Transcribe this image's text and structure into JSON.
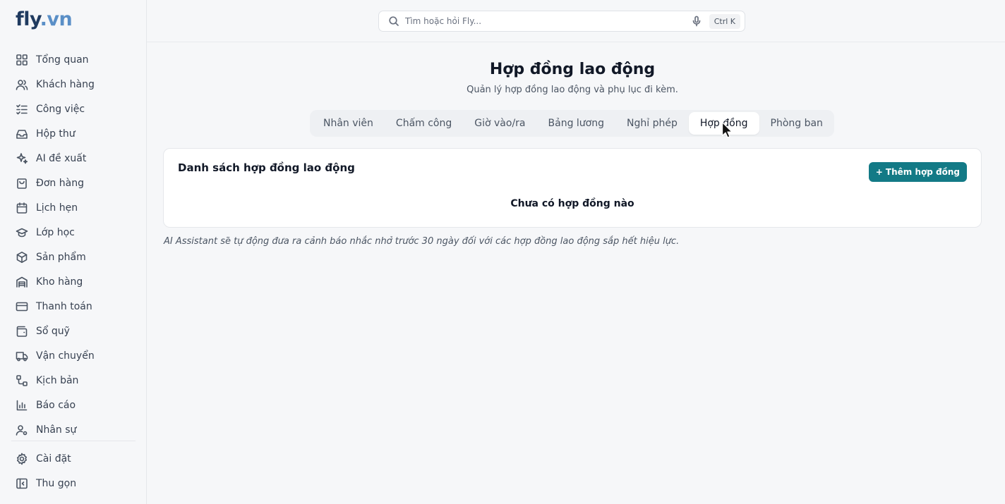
{
  "logo": {
    "part1": "fly",
    "part2": ".vn"
  },
  "search": {
    "placeholder": "Tìm hoặc hỏi Fly...",
    "shortcut": "Ctrl K"
  },
  "sidebar": {
    "items": [
      {
        "label": "Tổng quan",
        "icon": "grid-icon"
      },
      {
        "label": "Khách hàng",
        "icon": "users-icon"
      },
      {
        "label": "Công việc",
        "icon": "tasks-icon"
      },
      {
        "label": "Hộp thư",
        "icon": "inbox-icon"
      },
      {
        "label": "AI đề xuất",
        "icon": "sparkle-icon"
      },
      {
        "label": "Đơn hàng",
        "icon": "shopping-bag-icon"
      },
      {
        "label": "Lịch hẹn",
        "icon": "calendar-icon"
      },
      {
        "label": "Lớp học",
        "icon": "graduation-cap-icon"
      },
      {
        "label": "Sản phẩm",
        "icon": "box-icon"
      },
      {
        "label": "Kho hàng",
        "icon": "warehouse-icon"
      },
      {
        "label": "Thanh toán",
        "icon": "credit-card-icon"
      },
      {
        "label": "Sổ quỹ",
        "icon": "wallet-icon"
      },
      {
        "label": "Vận chuyển",
        "icon": "truck-icon"
      },
      {
        "label": "Kịch bản",
        "icon": "workflow-icon"
      },
      {
        "label": "Báo cáo",
        "icon": "bar-chart-icon"
      },
      {
        "label": "Nhân sự",
        "icon": "user-cog-icon"
      }
    ],
    "bottom": [
      {
        "label": "Cài đặt",
        "icon": "gear-icon"
      },
      {
        "label": "Thu gọn",
        "icon": "collapse-icon"
      }
    ]
  },
  "page": {
    "title": "Hợp đồng lao động",
    "subtitle": "Quản lý hợp đồng lao động và phụ lục đi kèm."
  },
  "tabs": [
    {
      "label": "Nhân viên"
    },
    {
      "label": "Chấm công"
    },
    {
      "label": "Giờ vào/ra"
    },
    {
      "label": "Bảng lương"
    },
    {
      "label": "Nghỉ phép"
    },
    {
      "label": "Hợp đồng"
    },
    {
      "label": "Phòng ban"
    }
  ],
  "active_tab": "Hợp đồng",
  "card": {
    "title": "Danh sách hợp đồng lao động",
    "add_button": "+ Thêm hợp đồng",
    "empty_text": "Chưa có hợp đồng nào"
  },
  "note": "AI Assistant sẽ tự động đưa ra cảnh báo nhắc nhở trước 30 ngày đối với các hợp đồng lao động sắp hết hiệu lực.",
  "colors": {
    "accent": "#137a86",
    "logo_dark": "#1f3a5f",
    "logo_light": "#5a8fc7"
  }
}
